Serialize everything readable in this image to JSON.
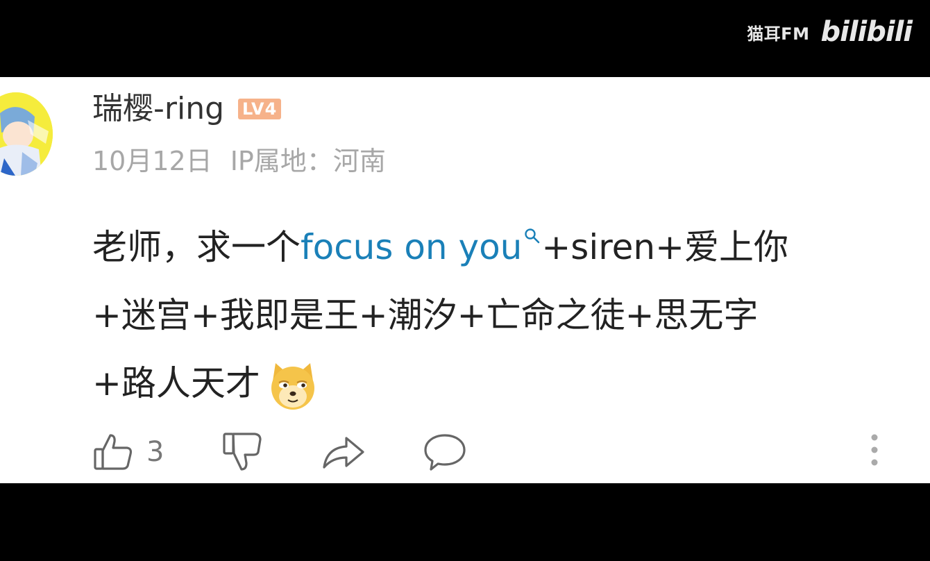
{
  "watermark": {
    "channel": "猫耳FM",
    "platform": "bilibili"
  },
  "comment": {
    "author": {
      "name": "瑞樱-ring",
      "level": "LV4",
      "avatar": "avatar-image"
    },
    "meta": {
      "date": "10月12日",
      "ip_location": "IP属地：河南"
    },
    "text": {
      "before_link": "老师，求一个",
      "link": "focus on you",
      "after_link_line1": "+siren+爱上你",
      "line2": "+迷宫+我即是王+潮汐+亡命之徒+思无字",
      "line3": "+路人天才",
      "emoji": "doge-emoji"
    },
    "actions": {
      "like_count": "3",
      "icons": [
        "thumbs-up-icon",
        "thumbs-down-icon",
        "share-icon",
        "reply-icon",
        "more-icon"
      ]
    }
  },
  "colors": {
    "link": "#1a80b8",
    "badge": "#f6b28a",
    "meta_text": "#a7a7a7",
    "icon": "#666666"
  }
}
